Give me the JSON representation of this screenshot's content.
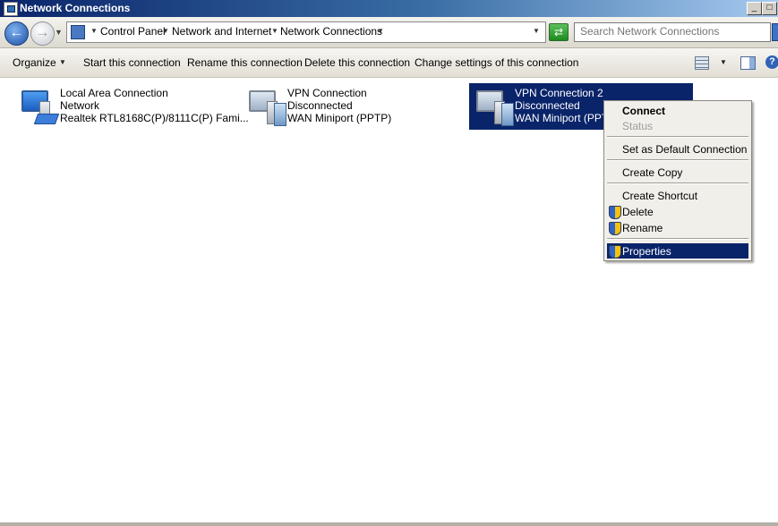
{
  "window": {
    "title": "Network Connections",
    "controls": {
      "minimize": "_",
      "maximize": "□"
    }
  },
  "address": {
    "breadcrumbs": [
      "Control Panel",
      "Network and Internet",
      "Network Connections"
    ],
    "search_placeholder": "Search Network Connections"
  },
  "toolbar": {
    "organize": "Organize",
    "start": "Start this connection",
    "rename": "Rename this connection",
    "delete": "Delete this connection",
    "change": "Change settings of this connection"
  },
  "connections": [
    {
      "name": "Local Area Connection",
      "status": "Network",
      "device": "Realtek RTL8168C(P)/8111C(P) Fami...",
      "icon": "lan-connection-icon",
      "selected": false
    },
    {
      "name": "VPN Connection",
      "status": "Disconnected",
      "device": "WAN Miniport (PPTP)",
      "icon": "vpn-connection-icon",
      "selected": false
    },
    {
      "name": "VPN Connection 2",
      "status": "Disconnected",
      "device": "WAN Miniport (PPTP)",
      "icon": "vpn-connection-icon",
      "selected": true
    }
  ],
  "context_menu": {
    "connect": "Connect",
    "status": "Status",
    "set_default": "Set as Default Connection",
    "create_copy": "Create Copy",
    "create_shortcut": "Create Shortcut",
    "delete": "Delete",
    "rename": "Rename",
    "properties": "Properties"
  },
  "colors": {
    "selection": "#0a246a",
    "menu_background": "#f1efe9"
  }
}
